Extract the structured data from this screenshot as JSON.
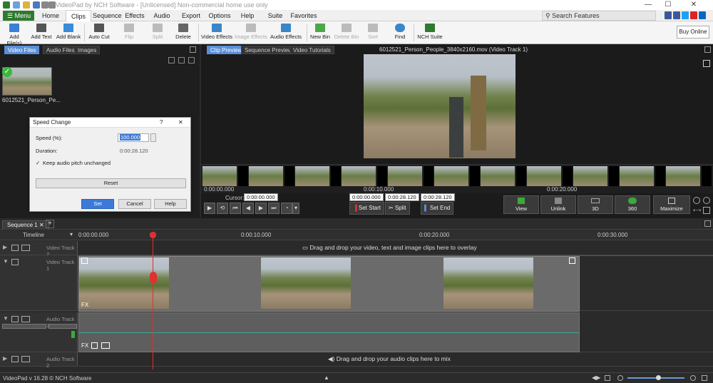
{
  "window": {
    "title": "VideoPad by NCH Software - [Unlicensed] Non-commercial home use only",
    "controls": [
      "—",
      "☐",
      "✕"
    ]
  },
  "menubar": {
    "menu_button": "☰ Menu ▾",
    "tabs": [
      "Home",
      "Clips",
      "Sequence",
      "Effects",
      "Audio",
      "Export",
      "Options",
      "Help",
      "Suite",
      "Favorites"
    ],
    "active_tab": "Clips",
    "search_placeholder": "Search Features"
  },
  "toolbar": {
    "buttons": [
      {
        "label": "Add File(s)",
        "color": "#3b7fd6",
        "enabled": true
      },
      {
        "label": "Add Text",
        "color": "#555555",
        "enabled": true
      },
      {
        "label": "Add Blank",
        "color": "#3a8bd9",
        "enabled": true
      },
      {
        "label": "Auto Cut",
        "color": "#555555",
        "enabled": true
      },
      {
        "label": "Flip",
        "color": "#aaaaaa",
        "enabled": false
      },
      {
        "label": "Split",
        "color": "#aaaaaa",
        "enabled": false
      },
      {
        "label": "Delete",
        "color": "#666666",
        "enabled": true
      },
      {
        "label": "Video Effects",
        "color": "#3a86c8",
        "enabled": true
      },
      {
        "label": "Image Effects",
        "color": "#aaaaaa",
        "enabled": false
      },
      {
        "label": "Audio Effects",
        "color": "#3a86c8",
        "enabled": true
      },
      {
        "label": "New Bin",
        "color": "#4aa84a",
        "enabled": true
      },
      {
        "label": "Delete Bin",
        "color": "#aaaaaa",
        "enabled": false
      },
      {
        "label": "Sort",
        "color": "#aaaaaa",
        "enabled": false
      },
      {
        "label": "Find",
        "color": "#3a86c8",
        "enabled": true
      },
      {
        "label": "NCH Suite",
        "color": "#2f7a30",
        "enabled": true
      }
    ],
    "buy_online": "Buy Online"
  },
  "media_bin": {
    "tabs": [
      "Video Files",
      "Audio Files",
      "Images"
    ],
    "active_tab": "Video Files",
    "clip_name": "6012521_Person_Pe..."
  },
  "speed_dialog": {
    "title": "Speed Change",
    "help_icon": "?",
    "close_icon": "✕",
    "speed_label": "Speed (%):",
    "speed_value": "100.000",
    "duration_label": "Duration:",
    "duration_value": "0:00:28.120",
    "keep_pitch_label": "Keep audio pitch unchanged",
    "keep_pitch_checked": true,
    "reset": "Reset",
    "set": "Set",
    "cancel": "Cancel",
    "help": "Help"
  },
  "preview": {
    "tabs": [
      "Clip Preview",
      "Sequence Preview",
      "Video Tutorials"
    ],
    "active_tab": "Clip Preview",
    "video_title": "6012521_Person_People_3840x2160.mov (Video Track 1)",
    "ruler": [
      "0:00:00.000",
      "0:00:10.000",
      "0:00:20.000"
    ],
    "cursor_label": "Cursor:",
    "cursor_value": "0:00:00.000",
    "in_time": "0:00:00.000",
    "out_time": "0:00:28.120",
    "duration": "0:00:28.120",
    "set_start": "Set Start",
    "split": "Split",
    "set_end": "Set End",
    "view": "View",
    "unlink": "Unlink",
    "three_d": "3D",
    "three_sixty": "360",
    "maximize": "Maximize"
  },
  "sequence": {
    "tab": "Sequence 1",
    "add_tab": "+",
    "timeline_label": "Timeline",
    "ruler": [
      "0:00:00.000",
      "0:00:10.000",
      "0:00:20.000",
      "0:00:30.000"
    ],
    "video_track_2": "Video Track 2",
    "video_track_1": "Video Track 1",
    "audio_track_1": "Audio Track 1",
    "audio_track_2": "Audio Track 2",
    "overlay_hint": "Drag and drop your video, text and image clips here to overlay",
    "audio_hint": "Drag and drop your audio clips here to mix"
  },
  "status": {
    "version": "VideoPad v 16.28 © NCH Software"
  },
  "colors": {
    "accent_blue": "#3d7ad8",
    "menu_green": "#2f7a30",
    "playhead_red": "#e03030"
  }
}
